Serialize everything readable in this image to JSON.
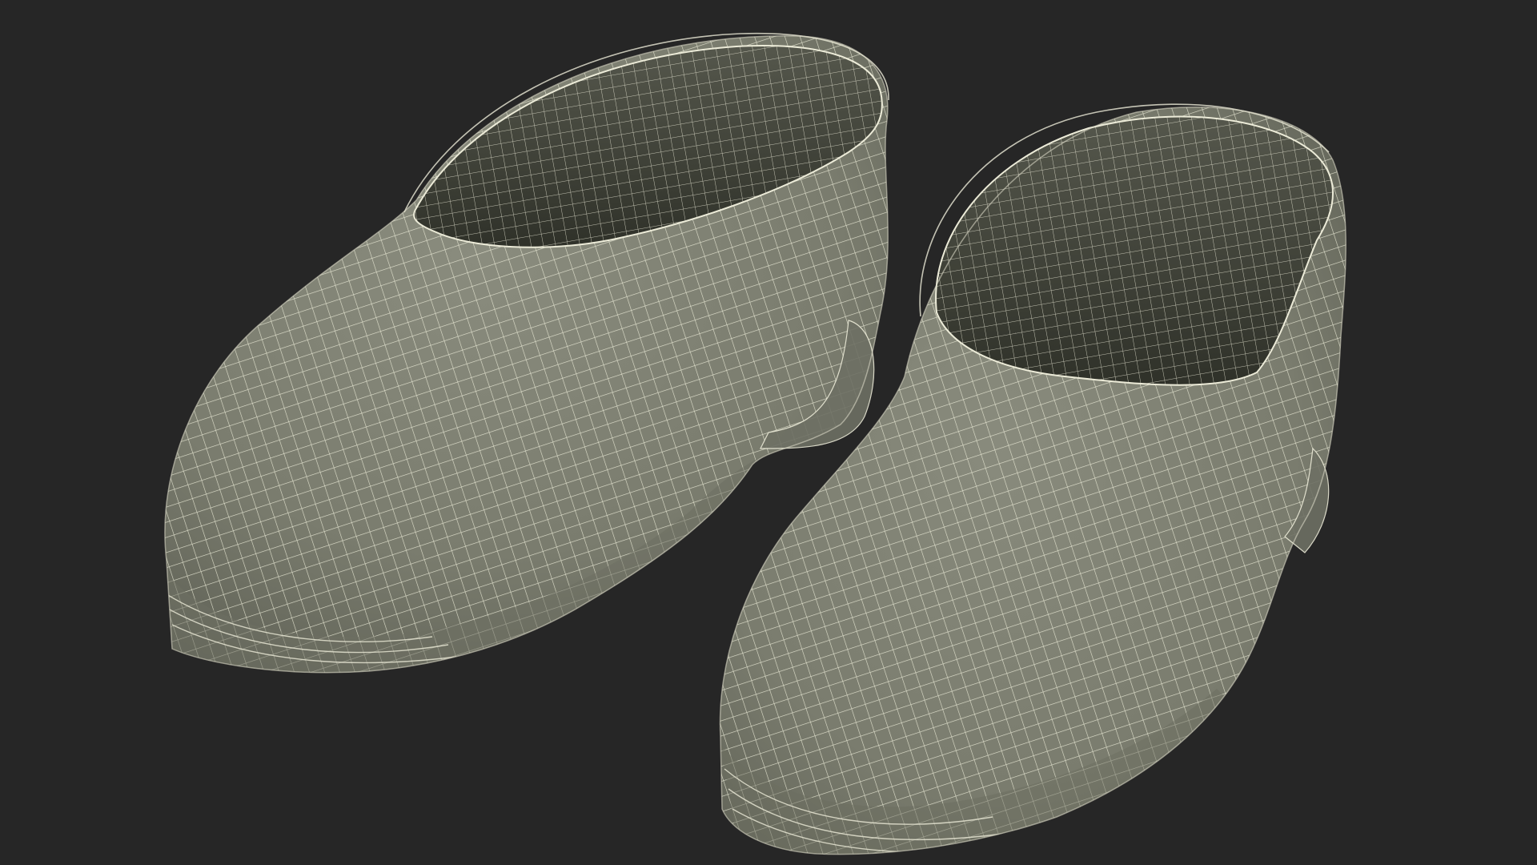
{
  "scene": {
    "background_color": "#262626",
    "surface_color": "#7b7d6f",
    "surface_dark": "#3e4037",
    "wire_color": "#ecebd8",
    "objects": [
      "shoe-left",
      "shoe-right"
    ]
  }
}
